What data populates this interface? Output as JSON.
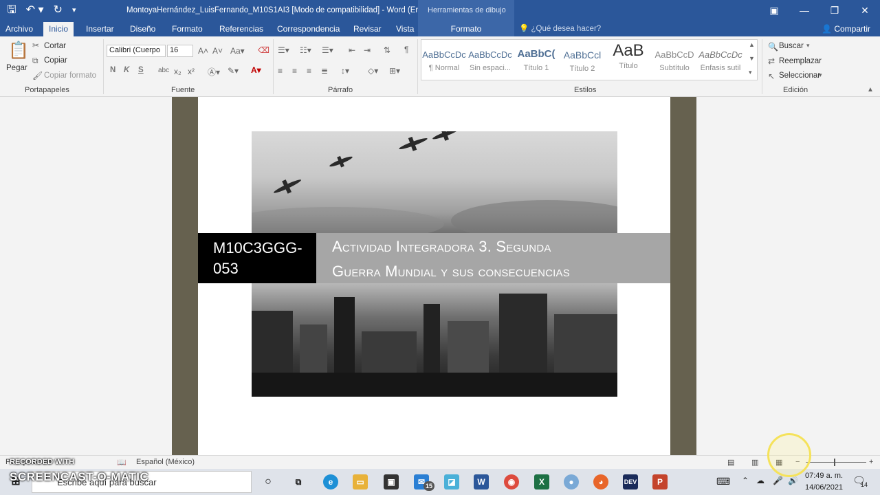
{
  "titlebar": {
    "document_title": "MontoyaHernández_LuisFernando_M10S1AI3 [Modo de compatibilidad] - Word (Er...",
    "contextual_header": "Herramientas de dibujo"
  },
  "tabs": {
    "items": [
      "Archivo",
      "Inicio",
      "Insertar",
      "Diseño",
      "Formato",
      "Referencias",
      "Correspondencia",
      "Revisar",
      "Vista"
    ],
    "active": "Inicio",
    "contextual": "Formato",
    "tell_me": "¿Qué desea hacer?",
    "share": "Compartir"
  },
  "clipboard": {
    "paste": "Pegar",
    "cut": "Cortar",
    "copy": "Copiar",
    "format_painter": "Copiar formato",
    "label": "Portapapeles"
  },
  "font": {
    "family": "Calibri (Cuerpo",
    "size": "16",
    "label": "Fuente",
    "bold": "N",
    "italic": "K",
    "underline": "S"
  },
  "paragraph": {
    "label": "Párrafo"
  },
  "styles": {
    "label": "Estilos",
    "items": [
      {
        "preview": "AaBbCcDc",
        "name": "¶ Normal"
      },
      {
        "preview": "AaBbCcDc",
        "name": "Sin espaci..."
      },
      {
        "preview": "AaBbC(",
        "name": "Título 1"
      },
      {
        "preview": "AaBbCcl",
        "name": "Título 2"
      },
      {
        "preview": "AaB",
        "name": "Título"
      },
      {
        "preview": "AaBbCcD",
        "name": "Subtítulo"
      },
      {
        "preview": "AaBbCcDc",
        "name": "Énfasis sutil"
      }
    ]
  },
  "editing": {
    "find": "Buscar",
    "replace": "Reemplazar",
    "select": "Seleccionar",
    "label": "Edición"
  },
  "document": {
    "code": "M10C3GGG-053",
    "title_line1": "Actividad Integradora 3. Segunda",
    "title_line2": "Guerra Mundial y sus consecuencias"
  },
  "statusbar": {
    "words": "Pa... palabras",
    "language": "Español (México)"
  },
  "taskbar": {
    "search_placeholder": "Escribe aquí para buscar",
    "time": "07:49 a. m.",
    "date": "14/06/2021",
    "mail_badge": "15",
    "notif_badge": "14"
  },
  "watermark": {
    "line1": "RECORDED WITH",
    "line2": "SCREENCAST-O-MATIC"
  },
  "colors": {
    "word_blue": "#2b579a",
    "banner_black": "#000000",
    "banner_gray": "#a6a6a6",
    "page_side": "#66614f"
  }
}
